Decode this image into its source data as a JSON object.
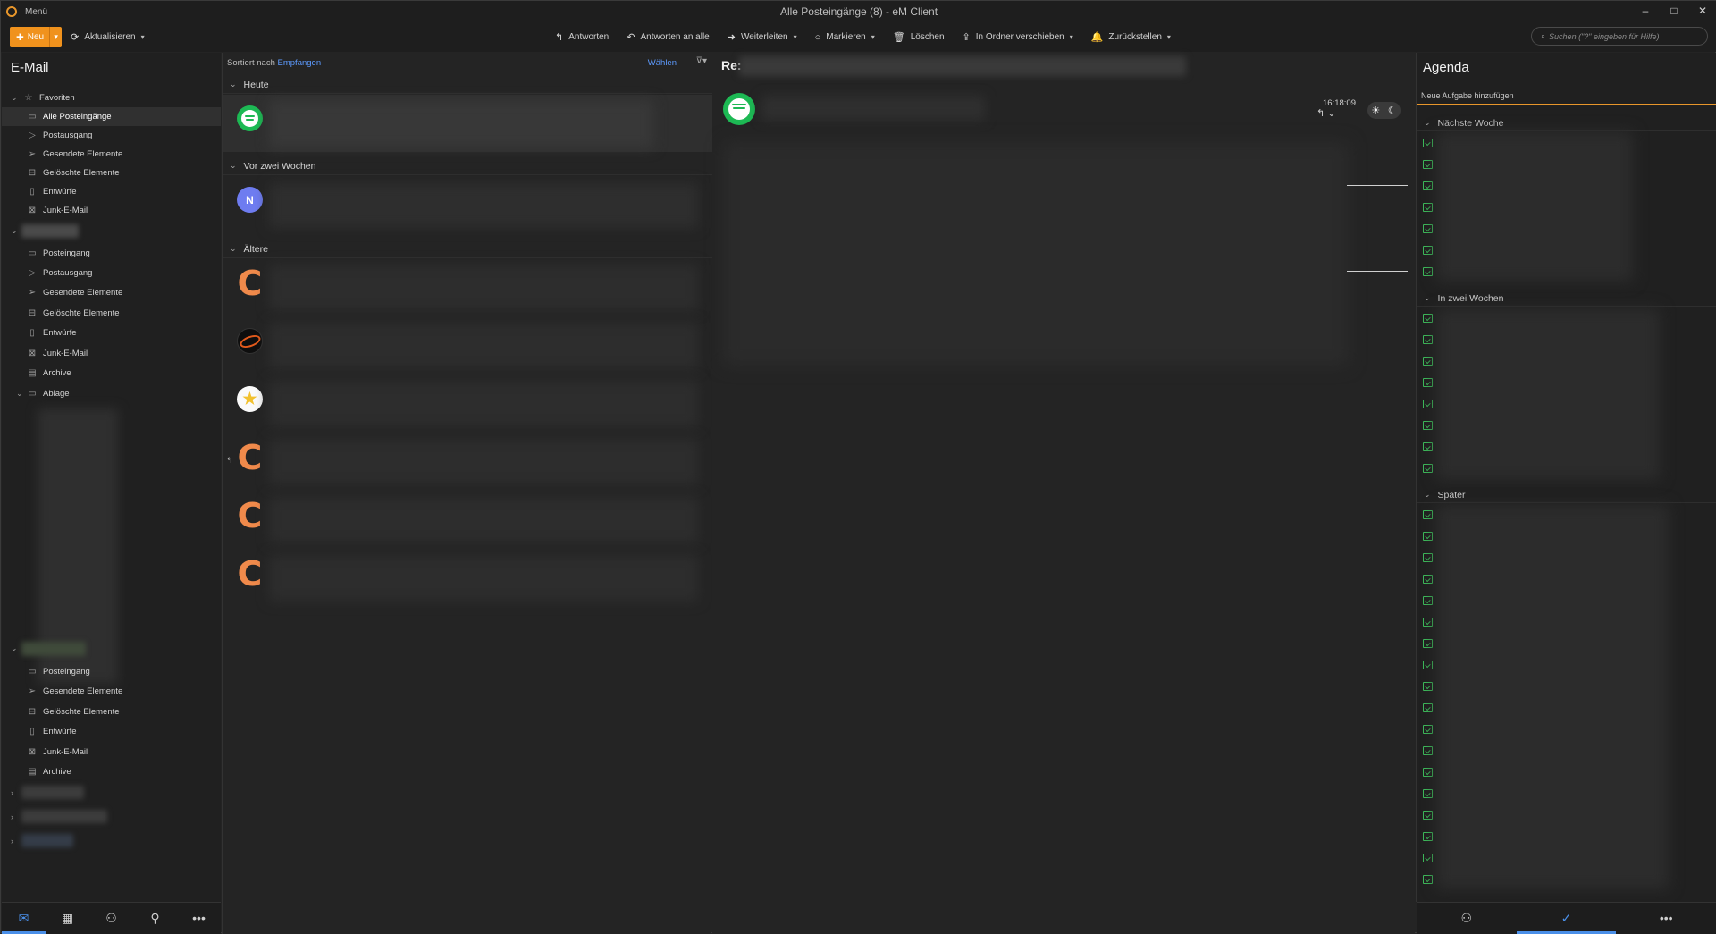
{
  "titlebar": {
    "menu_label": "Menü",
    "title": "Alle Posteingänge (8) - eM Client"
  },
  "toolbar": {
    "new_label": "Neu",
    "refresh_label": "Aktualisieren",
    "reply_label": "Antworten",
    "reply_all_label": "Antworten an alle",
    "forward_label": "Weiterleiten",
    "mark_label": "Markieren",
    "delete_label": "Löschen",
    "move_label": "In Ordner verschieben",
    "snooze_label": "Zurückstellen",
    "search_placeholder": "Suchen (\"?\" eingeben für Hilfe)"
  },
  "sidebar": {
    "title": "E-Mail",
    "favorites": "Favoriten",
    "fav_items": [
      "Alle Posteingänge",
      "Postausgang",
      "Gesendete Elemente",
      "Gelöschte Elemente",
      "Entwürfe",
      "Junk-E-Mail"
    ],
    "account1_items": [
      "Posteingang",
      "Postausgang",
      "Gesendete Elemente",
      "Gelöschte Elemente",
      "Entwürfe",
      "Junk-E-Mail",
      "Archive",
      "Ablage"
    ],
    "account2_items": [
      "Posteingang",
      "Gesendete Elemente",
      "Gelöschte Elemente",
      "Entwürfe",
      "Junk-E-Mail",
      "Archive"
    ],
    "icons": [
      "mail-icon",
      "calendar-icon",
      "contacts-icon",
      "attachment-icon",
      "more-icon"
    ]
  },
  "list": {
    "sort_prefix": "Sortiert nach",
    "sort_field": "Empfangen",
    "select_label": "Wählen",
    "groups": [
      "Heute",
      "Vor zwei Wochen",
      "Ältere"
    ],
    "avatars": {
      "n_letter": "N",
      "c_letter": "C"
    }
  },
  "reading": {
    "subject_prefix": "Re:",
    "time": "16:18:09"
  },
  "agenda": {
    "title": "Agenda",
    "new_task": "Neue Aufgabe hinzufügen",
    "groups": [
      "Nächste Woche",
      "In zwei Wochen",
      "Später"
    ],
    "accent": "#e8962b",
    "task_icon_color": "#3dbb5a"
  },
  "colors": {
    "accent_orange": "#f0921d",
    "link_blue": "#5d9bff",
    "active_blue": "#4a8fe8"
  }
}
